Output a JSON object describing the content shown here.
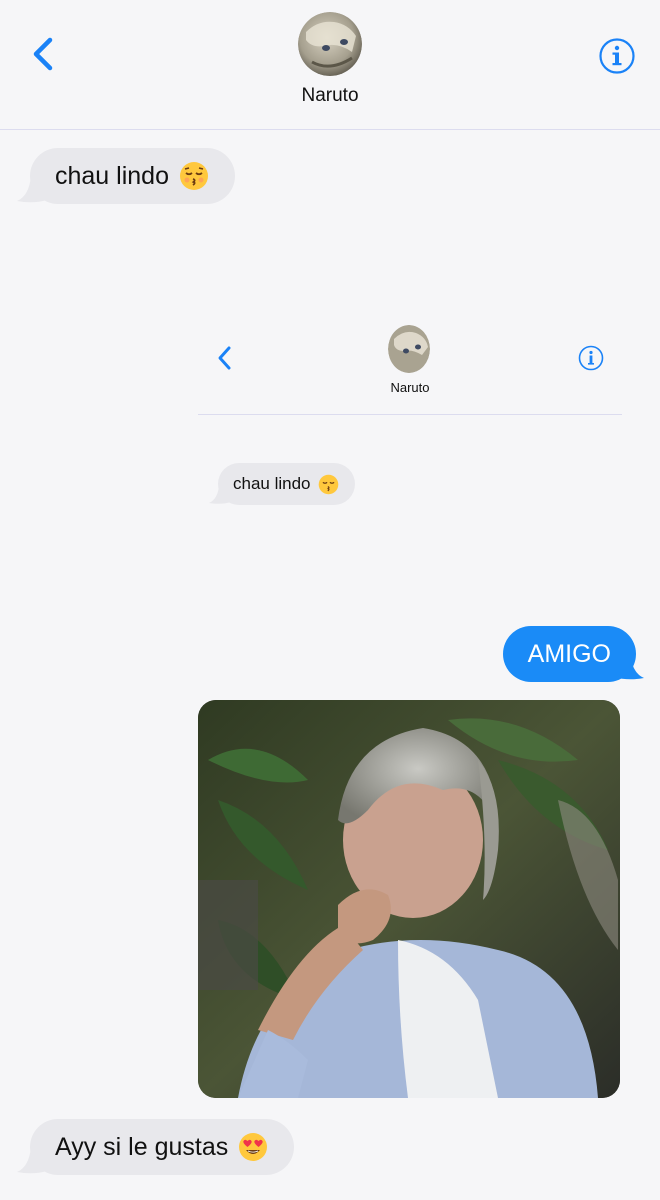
{
  "header": {
    "contact_name": "Naruto",
    "back_icon": "chevron-left-icon",
    "info_icon": "info-icon",
    "accent_color": "#1a82f7"
  },
  "messages": [
    {
      "direction": "received",
      "text": "chau lindo",
      "emoji": "kissing-face-closed-eyes"
    },
    {
      "direction": "received",
      "type": "image",
      "description_icon": "screenshot-image"
    },
    {
      "direction": "sent",
      "text": "AMIGO"
    },
    {
      "direction": "sent",
      "type": "image",
      "description_icon": "gif-image"
    },
    {
      "direction": "received",
      "text": "Ayy si le gustas",
      "emoji": "heart-eyes-face"
    }
  ],
  "nested_screenshot": {
    "contact_name": "Naruto",
    "message_text": "chau lindo"
  },
  "colors": {
    "sent_bubble": "#1a8bf7",
    "received_bubble": "#e8e8ec",
    "background": "#f6f6f8"
  }
}
